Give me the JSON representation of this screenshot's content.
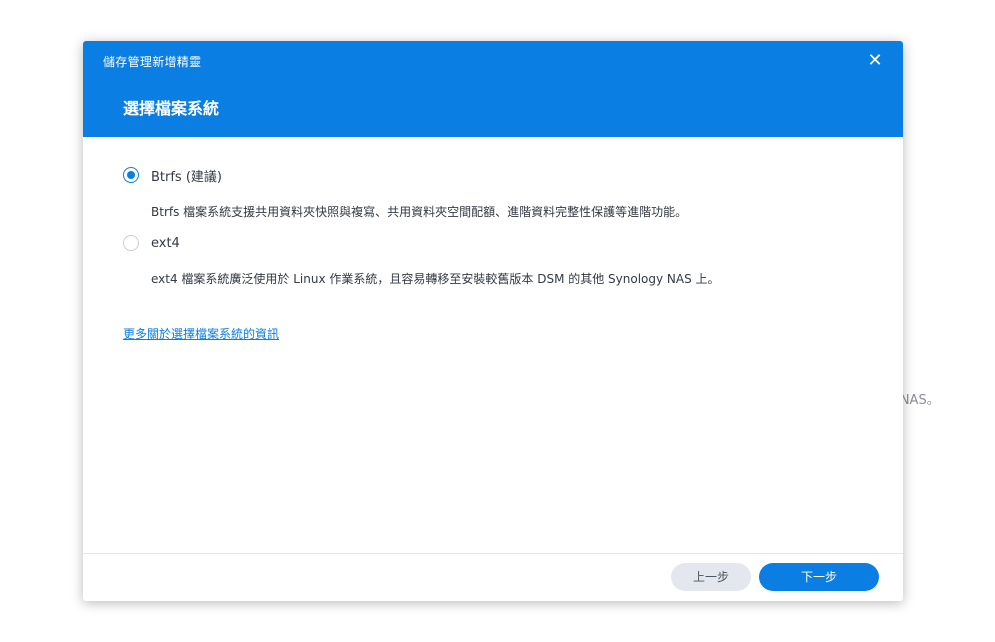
{
  "background": {
    "partial_text": "y NAS。"
  },
  "dialog": {
    "app_title": "儲存管理新增精靈",
    "step_title": "選擇檔案系統",
    "close_icon": "close-icon",
    "accent_color": "#0b7ee4",
    "options": [
      {
        "label": "Btrfs (建議)",
        "description": "Btrfs 檔案系統支援共用資料夾快照與複寫、共用資料夾空間配額、進階資料完整性保護等進階功能。",
        "selected": true
      },
      {
        "label": "ext4",
        "description": "ext4 檔案系統廣泛使用於 Linux 作業系統，且容易轉移至安裝較舊版本 DSM 的其他 Synology NAS 上。",
        "selected": false
      }
    ],
    "more_info_link": "更多關於選擇檔案系統的資訊",
    "footer": {
      "prev_label": "上一步",
      "next_label": "下一步"
    }
  }
}
